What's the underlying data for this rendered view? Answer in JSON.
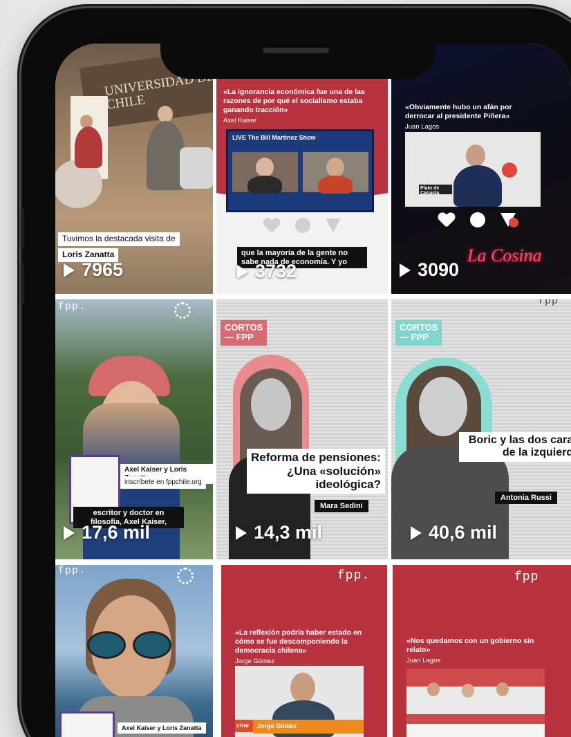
{
  "tiles": [
    {
      "id": "t1",
      "caption_line1": "Tuvimos la destacada visita de",
      "caption_line2": "Loris Zanatta",
      "views": "7965",
      "sign_text": "UNIVERSIDAD DE CHILE"
    },
    {
      "id": "t2",
      "quote": "«La ignorancia económica fue una de las razones de por qué el socialismo estaba ganando tracción»",
      "author": "Axel Kaiser",
      "show_title": "LIVE The Bill Martinez Show",
      "caption": "que la mayoría de la gente no sabe nada de economía. Y yo",
      "views": "3732"
    },
    {
      "id": "t3",
      "quote": "«Obviamente hubo un afán por derrocar al presidente Piñera»",
      "author": "Juan Lagos",
      "lower_third": "Plato de Canasta",
      "views": "3090",
      "logo_text": "La Cosina"
    },
    {
      "id": "t4",
      "brand": "fpp.",
      "book_label": "Axel Kaiser y Loris Zanatta",
      "site": "inscríbete en fppchile.org",
      "caption": "escritor y doctor en filosofía, Axel Kaiser,",
      "views": "17,6 mil"
    },
    {
      "id": "t5",
      "series_line1": "CORTOS",
      "series_line2": "— FPP",
      "title": "Reforma de pensiones: ¿Una «solución» ideológica?",
      "name": "Mara Sedini",
      "views": "14,3 mil"
    },
    {
      "id": "t6",
      "series_line1": "CORTOS",
      "series_line2": "— FPP",
      "title": "Boric y las dos caras de la izquierda",
      "name": "Antonia Russi",
      "views": "40,6 mil",
      "brand": "fpp"
    },
    {
      "id": "t7",
      "brand": "fpp.",
      "book_label": "Axel Kaiser y Loris Zanatta"
    },
    {
      "id": "t8",
      "brand": "fpp.",
      "quote": "«La reflexión podría haber estado en cómo se fue descomponiendo la democracia chilena»",
      "author": "Jorge Gómez",
      "lower_third": "Jorge Gómez",
      "channel": "cine"
    },
    {
      "id": "t9",
      "brand": "fpp",
      "quote": "«Nos quedamos con un gobierno sin relato»",
      "author": "Juan Lagos"
    }
  ],
  "colors": {
    "fpp_red": "#b8333f",
    "teal": "#7fd6cc",
    "dark": "#111111"
  },
  "icons": {
    "heart": "heart-icon",
    "comment": "comment-icon",
    "share": "send-icon",
    "play": "play-icon"
  }
}
